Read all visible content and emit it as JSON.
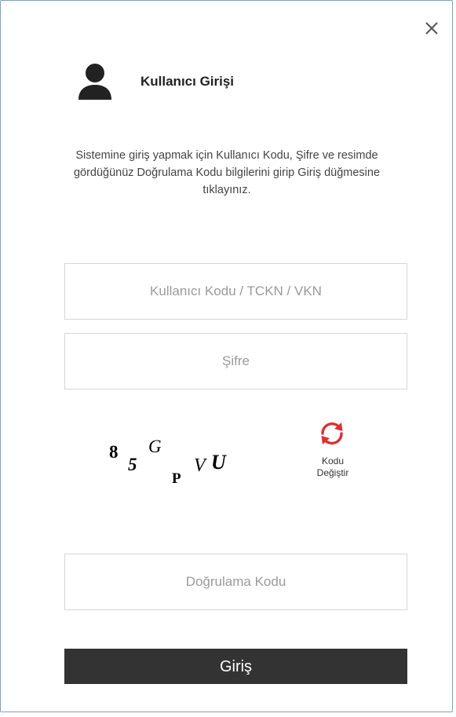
{
  "dialog": {
    "close_icon": "close-icon",
    "title": "Kullanıcı Girişi",
    "user_icon": "user-icon",
    "description": "Sistemine giriş yapmak için Kullanıcı Kodu, Şifre ve resimde gördüğünüz Doğrulama Kodu bilgilerini girip Giriş düğmesine tıklayınız.",
    "fields": {
      "username": {
        "value": "",
        "placeholder": "Kullanıcı Kodu / TCKN / VKN"
      },
      "password": {
        "value": "",
        "placeholder": "Şifre"
      },
      "captcha_input": {
        "value": "",
        "placeholder": "Doğrulama Kodu"
      }
    },
    "captcha": {
      "characters": [
        "8",
        "5",
        "G",
        "P",
        "V",
        "U"
      ]
    },
    "refresh": {
      "icon": "refresh-icon",
      "label_line1": "Kodu",
      "label_line2": "Değiştir"
    },
    "submit_label": "Giriş"
  },
  "colors": {
    "border": "#7f9fbf",
    "field_border": "#d6d6d6",
    "button_bg": "#333333",
    "button_text": "#ffffff",
    "refresh_red": "#e03030",
    "placeholder": "#9a9a9a"
  }
}
